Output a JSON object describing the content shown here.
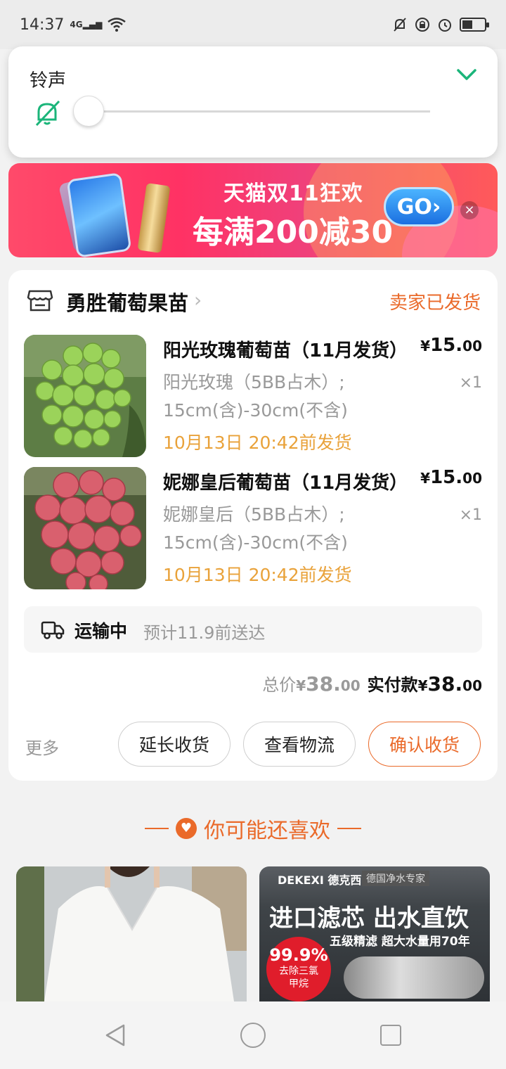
{
  "status_bar": {
    "time": "14:37",
    "network": "4G"
  },
  "volume_panel": {
    "title": "铃声",
    "level": 0,
    "collapse_icon": "chevron-down-icon",
    "mute_icon": "bell-off-icon",
    "accent_color": "#1bb57a"
  },
  "banner": {
    "line1": "天猫双11狂欢",
    "line2": "每满200减30",
    "go_label": "GO",
    "close_label": "×"
  },
  "order": {
    "shop_name": "勇胜葡萄果苗",
    "status": "卖家已发货",
    "items": [
      {
        "title": "阳光玫瑰葡萄苗（11月发货）",
        "price_currency": "¥",
        "price_int": "15.",
        "price_dec": "00",
        "spec_line1": "阳光玫瑰（5BB占木）;",
        "spec_line2": "15cm(含)-30cm(不含)",
        "qty": "×1",
        "ship_deadline": "10月13日 20:42前发货"
      },
      {
        "title": "妮娜皇后葡萄苗（11月发货）",
        "price_currency": "¥",
        "price_int": "15.",
        "price_dec": "00",
        "spec_line1": "妮娜皇后（5BB占木）;",
        "spec_line2": "15cm(含)-30cm(不含)",
        "qty": "×1",
        "ship_deadline": "10月13日 20:42前发货"
      }
    ],
    "transport": {
      "label": "运输中",
      "eta": "预计11.9前送达"
    },
    "totals": {
      "total_label": "总价",
      "total_currency": "¥",
      "total_int": "38.",
      "total_dec": "00",
      "paid_label": "实付款",
      "paid_currency": "¥",
      "paid_int": "38.",
      "paid_dec": "00"
    },
    "more_label": "更多",
    "buttons": {
      "extend": "延长收货",
      "logistics": "查看物流",
      "confirm": "确认收货"
    },
    "accent_color": "#ea6a2a"
  },
  "recommend": {
    "title": "你可能还喜欢",
    "card2": {
      "brand": "DEKEXI 德克西",
      "tag": "德国净水专家",
      "headline": "进口滤芯 出水直饮",
      "subline": "五级精滤 超大水量用70年",
      "badge_percent": "99.9%",
      "badge_text1": "去除三氯",
      "badge_text2": "甲烷"
    }
  }
}
